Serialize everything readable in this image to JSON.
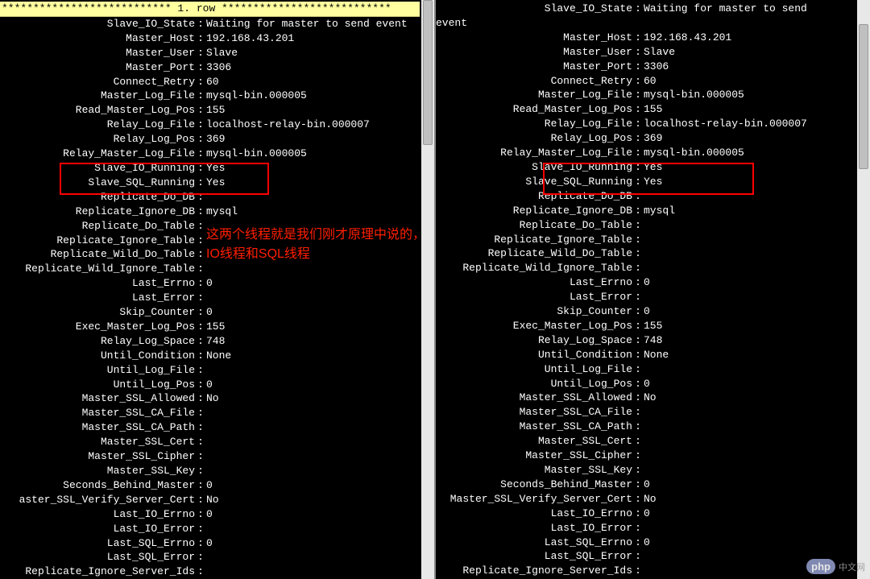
{
  "header": "*************************** 1. row ***************************",
  "annotation": {
    "line1": "这两个线程就是我们刚才原理中说的，",
    "line2": "IO线程和SQL线程"
  },
  "watermark": {
    "badge": "php",
    "text": "中文网"
  },
  "left": [
    {
      "label": "Slave_IO_State",
      "value": "Waiting for master to send event"
    },
    {
      "label": "Master_Host",
      "value": "192.168.43.201"
    },
    {
      "label": "Master_User",
      "value": "Slave"
    },
    {
      "label": "Master_Port",
      "value": "3306"
    },
    {
      "label": "Connect_Retry",
      "value": "60"
    },
    {
      "label": "Master_Log_File",
      "value": "mysql-bin.000005"
    },
    {
      "label": "Read_Master_Log_Pos",
      "value": "155"
    },
    {
      "label": "Relay_Log_File",
      "value": "localhost-relay-bin.000007"
    },
    {
      "label": "Relay_Log_Pos",
      "value": "369"
    },
    {
      "label": "Relay_Master_Log_File",
      "value": "mysql-bin.000005"
    },
    {
      "label": "Slave_IO_Running",
      "value": "Yes"
    },
    {
      "label": "Slave_SQL_Running",
      "value": "Yes"
    },
    {
      "label": "Replicate_Do_DB",
      "value": ""
    },
    {
      "label": "Replicate_Ignore_DB",
      "value": "mysql"
    },
    {
      "label": "Replicate_Do_Table",
      "value": ""
    },
    {
      "label": "Replicate_Ignore_Table",
      "value": ""
    },
    {
      "label": "Replicate_Wild_Do_Table",
      "value": ""
    },
    {
      "label": "Replicate_Wild_Ignore_Table",
      "value": ""
    },
    {
      "label": "Last_Errno",
      "value": "0"
    },
    {
      "label": "Last_Error",
      "value": ""
    },
    {
      "label": "Skip_Counter",
      "value": "0"
    },
    {
      "label": "Exec_Master_Log_Pos",
      "value": "155"
    },
    {
      "label": "Relay_Log_Space",
      "value": "748"
    },
    {
      "label": "Until_Condition",
      "value": "None"
    },
    {
      "label": "Until_Log_File",
      "value": ""
    },
    {
      "label": "Until_Log_Pos",
      "value": "0"
    },
    {
      "label": "Master_SSL_Allowed",
      "value": "No"
    },
    {
      "label": "Master_SSL_CA_File",
      "value": ""
    },
    {
      "label": "Master_SSL_CA_Path",
      "value": ""
    },
    {
      "label": "Master_SSL_Cert",
      "value": ""
    },
    {
      "label": "Master_SSL_Cipher",
      "value": ""
    },
    {
      "label": "Master_SSL_Key",
      "value": ""
    },
    {
      "label": "Seconds_Behind_Master",
      "value": "0"
    },
    {
      "label": "aster_SSL_Verify_Server_Cert",
      "value": "No"
    },
    {
      "label": "Last_IO_Errno",
      "value": "0"
    },
    {
      "label": "Last_IO_Error",
      "value": ""
    },
    {
      "label": "Last_SQL_Errno",
      "value": "0"
    },
    {
      "label": "Last_SQL_Error",
      "value": ""
    },
    {
      "label": "Replicate_Ignore_Server_Ids",
      "value": ""
    }
  ],
  "right_first": {
    "label": "Slave_IO_State",
    "value": "Waiting for master to send"
  },
  "right_wrap": "event",
  "right": [
    {
      "label": "Master_Host",
      "value": "192.168.43.201"
    },
    {
      "label": "Master_User",
      "value": "Slave"
    },
    {
      "label": "Master_Port",
      "value": "3306"
    },
    {
      "label": "Connect_Retry",
      "value": "60"
    },
    {
      "label": "Master_Log_File",
      "value": "mysql-bin.000005"
    },
    {
      "label": "Read_Master_Log_Pos",
      "value": "155"
    },
    {
      "label": "Relay_Log_File",
      "value": "localhost-relay-bin.000007"
    },
    {
      "label": "Relay_Log_Pos",
      "value": "369"
    },
    {
      "label": "Relay_Master_Log_File",
      "value": "mysql-bin.000005"
    },
    {
      "label": "Slave_IO_Running",
      "value": "Yes"
    },
    {
      "label": "Slave_SQL_Running",
      "value": "Yes"
    },
    {
      "label": "Replicate_Do_DB",
      "value": ""
    },
    {
      "label": "Replicate_Ignore_DB",
      "value": "mysql"
    },
    {
      "label": "Replicate_Do_Table",
      "value": ""
    },
    {
      "label": "Replicate_Ignore_Table",
      "value": ""
    },
    {
      "label": "Replicate_Wild_Do_Table",
      "value": ""
    },
    {
      "label": "Replicate_Wild_Ignore_Table",
      "value": ""
    },
    {
      "label": "Last_Errno",
      "value": "0"
    },
    {
      "label": "Last_Error",
      "value": ""
    },
    {
      "label": "Skip_Counter",
      "value": "0"
    },
    {
      "label": "Exec_Master_Log_Pos",
      "value": "155"
    },
    {
      "label": "Relay_Log_Space",
      "value": "748"
    },
    {
      "label": "Until_Condition",
      "value": "None"
    },
    {
      "label": "Until_Log_File",
      "value": ""
    },
    {
      "label": "Until_Log_Pos",
      "value": "0"
    },
    {
      "label": "Master_SSL_Allowed",
      "value": "No"
    },
    {
      "label": "Master_SSL_CA_File",
      "value": ""
    },
    {
      "label": "Master_SSL_CA_Path",
      "value": ""
    },
    {
      "label": "Master_SSL_Cert",
      "value": ""
    },
    {
      "label": "Master_SSL_Cipher",
      "value": ""
    },
    {
      "label": "Master_SSL_Key",
      "value": ""
    },
    {
      "label": "Seconds_Behind_Master",
      "value": "0"
    },
    {
      "label": "Master_SSL_Verify_Server_Cert",
      "value": "No"
    },
    {
      "label": "Last_IO_Errno",
      "value": "0"
    },
    {
      "label": "Last_IO_Error",
      "value": ""
    },
    {
      "label": "Last_SQL_Errno",
      "value": "0"
    },
    {
      "label": "Last_SQL_Error",
      "value": ""
    },
    {
      "label": "Replicate_Ignore_Server_Ids",
      "value": ""
    }
  ]
}
